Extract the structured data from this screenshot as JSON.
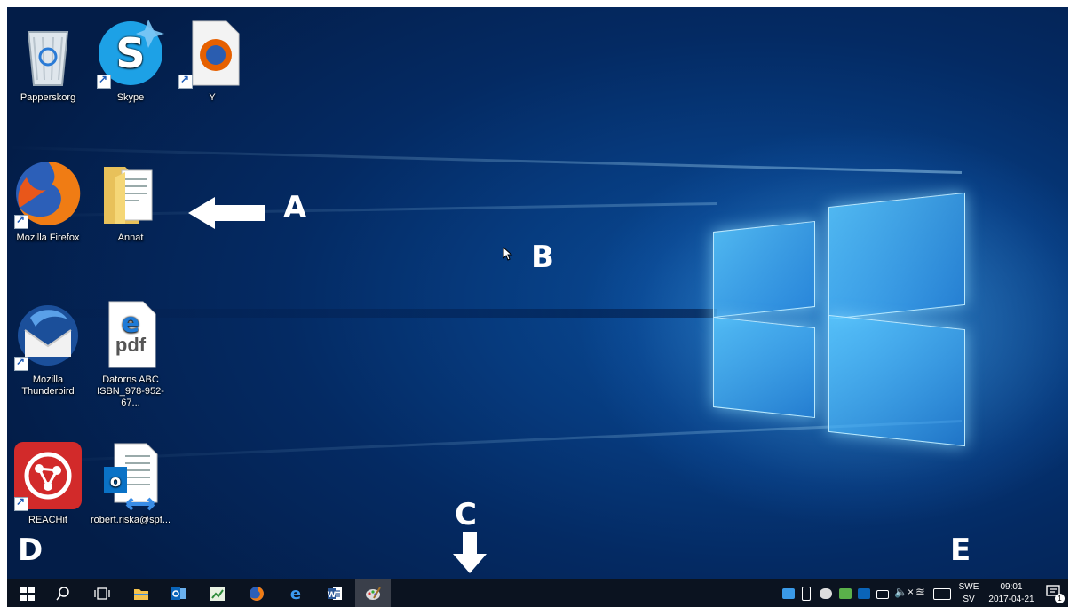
{
  "desktop_icons": {
    "recycle_bin": "Papperskorg",
    "skype": "Skype",
    "y_file": "Y",
    "firefox": "Mozilla Firefox",
    "annat": "Annat",
    "thunderbird": "Mozilla Thunderbird",
    "pdf_doc": "Datorns ABC ISBN_978-952-67...",
    "reachit": "REACHit",
    "outlook_file": "robert.riska@spf..."
  },
  "pdf_glyph": "pdf",
  "markers": {
    "a": "A",
    "b": "B",
    "c": "C",
    "d": "D",
    "e": "E"
  },
  "tray": {
    "lang_top": "SWE",
    "lang_bottom": "SV",
    "time": "09:01",
    "date": "2017-04-21",
    "notification_count": "1"
  },
  "colors": {
    "taskbar": "#0b1320",
    "desktop": "#063a7d",
    "accent": "#3aa0ff"
  }
}
